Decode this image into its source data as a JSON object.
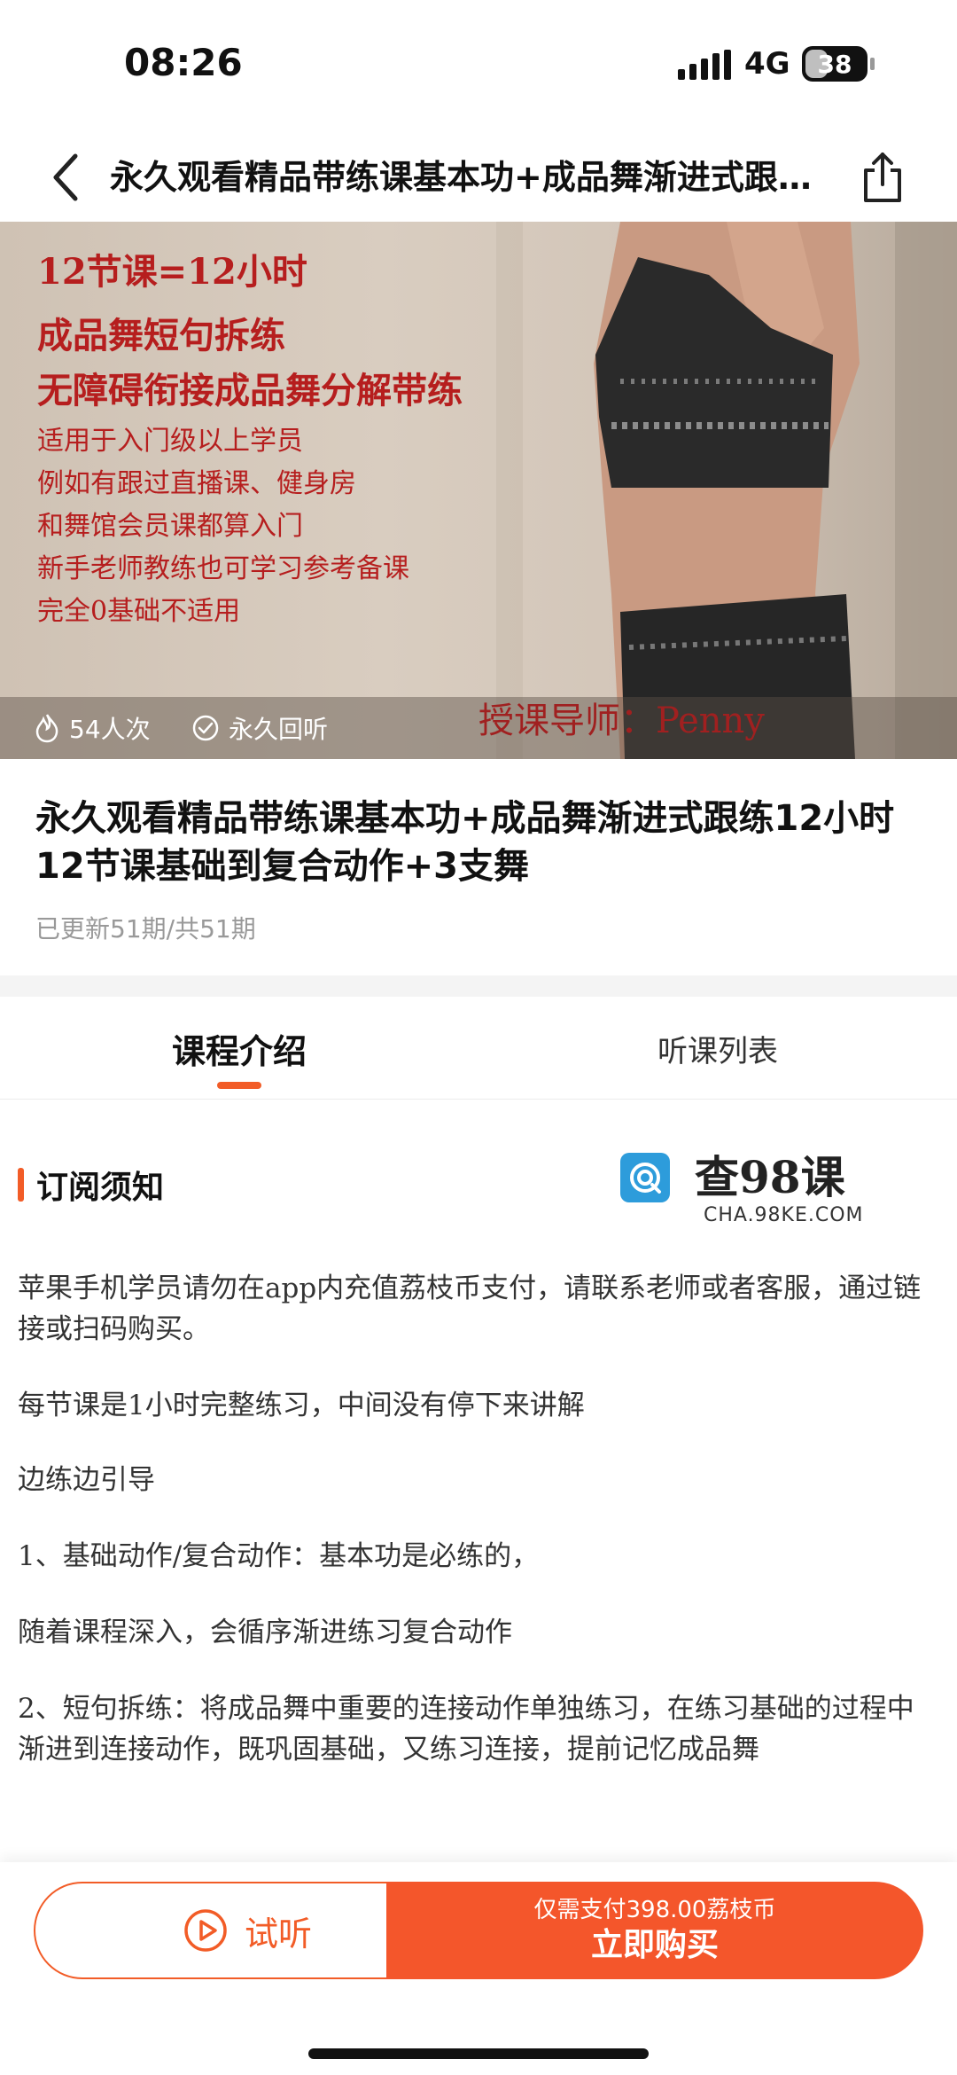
{
  "status_bar": {
    "time": "08:26",
    "network": "4G",
    "battery": "38",
    "battery_level": 0.38
  },
  "nav": {
    "title": "永久观看精品带练课基本功+成品舞渐进式跟练12小时12节课基础到复合动作+3支舞",
    "back_icon": "back-arrow-icon",
    "share_icon": "share-icon"
  },
  "cover": {
    "lines_big": [
      "12节课=12小时",
      "成品舞短句拆练",
      "无障碍衔接成品舞分解带练"
    ],
    "lines_small": [
      "适用于入门级以上学员",
      "例如有跟过直播课、健身房",
      "和舞馆会员课都算入门",
      "新手老师教练也可学习参考备课",
      "完全0基础不适用"
    ],
    "teacher": "授课导师：Penny",
    "views": "54人次",
    "access": "永久回听"
  },
  "course": {
    "title": "永久观看精品带练课基本功+成品舞渐进式跟练12小时12节课基础到复合动作+3支舞",
    "progress": "已更新51期/共51期"
  },
  "tabs": [
    {
      "label": "课程介绍",
      "active": true
    },
    {
      "label": "听课列表",
      "active": false
    }
  ],
  "section": {
    "title": "订阅须知"
  },
  "watermark": {
    "title": "查98课",
    "subtitle": "CHA.98KE.COM"
  },
  "paragraphs": [
    "苹果手机学员请勿在app内充值荔枝币支付，请联系老师或者客服，通过链接或扫码购买。",
    "每节课是1小时完整练习，中间没有停下来讲解",
    "边练边引导",
    "1、基础动作/复合动作：基本功是必练的，",
    "随着课程深入，会循序渐进练习复合动作",
    "2、短句拆练：将成品舞中重要的连接动作单独练习，在练习基础的过程中渐进到连接动作，既巩固基础，又练习连接，提前记忆成品舞"
  ],
  "bottom": {
    "try_label": "试听",
    "buy_price": "仅需支付398.00荔枝币",
    "buy_label": "立即购买"
  },
  "colors": {
    "accent": "#f25c27",
    "buy_bg": "#f4562b",
    "cover_text": "#b61e1e"
  }
}
